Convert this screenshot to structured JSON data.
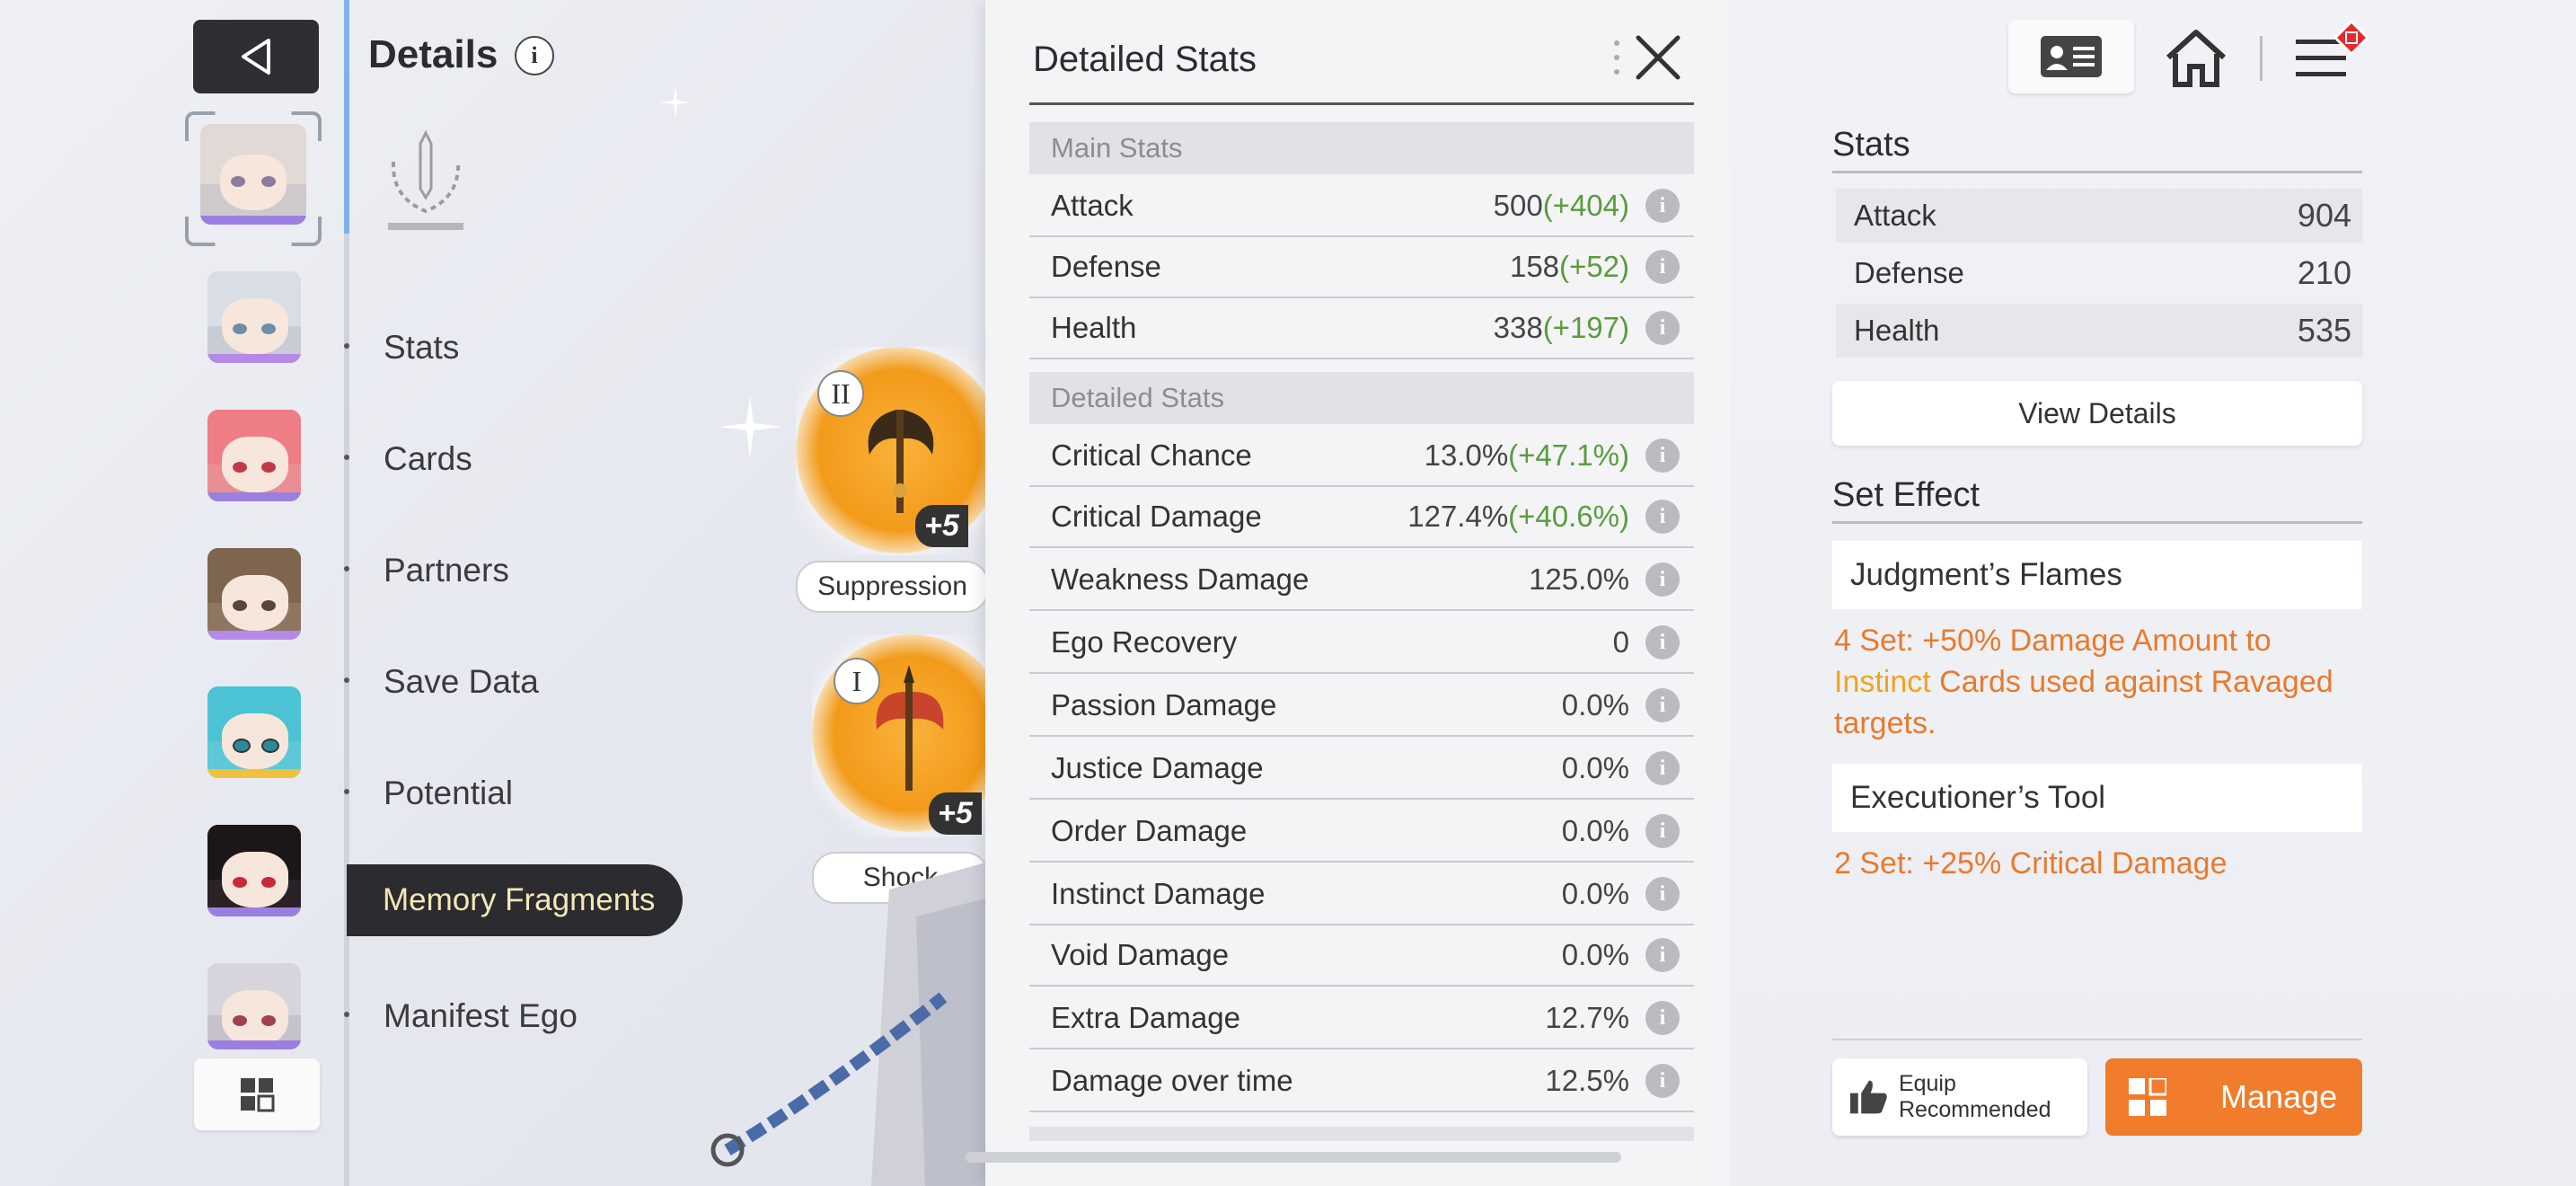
{
  "nav": {
    "title": "Details",
    "info_glyph": "i",
    "items": [
      "Stats",
      "Cards",
      "Partners",
      "Save Data",
      "Potential",
      "Memory Fragments",
      "Manifest Ego"
    ],
    "active": "Memory Fragments"
  },
  "fragments": [
    {
      "slot": "II",
      "level": "+5",
      "tag": "Suppression"
    },
    {
      "slot": "I",
      "level": "+5",
      "tag": "Shock"
    }
  ],
  "detailed_panel": {
    "title": "Detailed Stats",
    "main_section": "Main Stats",
    "main_stats": [
      {
        "name": "Attack",
        "value": "500",
        "bonus": "(+404)"
      },
      {
        "name": "Defense",
        "value": "158",
        "bonus": "(+52)"
      },
      {
        "name": "Health",
        "value": "338",
        "bonus": "(+197)"
      }
    ],
    "detail_section": "Detailed Stats",
    "detail_stats": [
      {
        "name": "Critical Chance",
        "value": "13.0%",
        "bonus": "(+47.1%)"
      },
      {
        "name": "Critical Damage",
        "value": "127.4%",
        "bonus": "(+40.6%)"
      },
      {
        "name": "Weakness Damage",
        "value": "125.0%",
        "bonus": ""
      },
      {
        "name": "Ego Recovery",
        "value": "0",
        "bonus": ""
      },
      {
        "name": "Passion Damage",
        "value": "0.0%",
        "bonus": ""
      },
      {
        "name": "Justice Damage",
        "value": "0.0%",
        "bonus": ""
      },
      {
        "name": "Order Damage",
        "value": "0.0%",
        "bonus": ""
      },
      {
        "name": "Instinct Damage",
        "value": "0.0%",
        "bonus": ""
      },
      {
        "name": "Void Damage",
        "value": "0.0%",
        "bonus": ""
      },
      {
        "name": "Extra Damage",
        "value": "12.7%",
        "bonus": ""
      },
      {
        "name": "Damage over time",
        "value": "12.5%",
        "bonus": ""
      }
    ]
  },
  "right_panel": {
    "stats_header": "Stats",
    "stats": [
      {
        "name": "Attack",
        "value": "904"
      },
      {
        "name": "Defense",
        "value": "210"
      },
      {
        "name": "Health",
        "value": "535"
      }
    ],
    "view_details": "View Details",
    "set_effect_header": "Set Effect",
    "sets": [
      {
        "name": "Judgment’s Flames",
        "desc_a": "4 Set: +50% Damage Amount to ",
        "desc_kw": "Instinct",
        "desc_b": " Cards used against Ravaged targets."
      },
      {
        "name": "Executioner’s Tool",
        "desc_a": "2 Set: +25% Critical Damage",
        "desc_kw": "",
        "desc_b": ""
      }
    ],
    "equip_recommended": "Equip Recommended",
    "manage": "Manage"
  },
  "colors": {
    "accent_orange": "#f07c2c",
    "bonus_green": "#5a9c3e",
    "keyword_gold": "#f0a41c",
    "set_text": "#e97a2c"
  }
}
